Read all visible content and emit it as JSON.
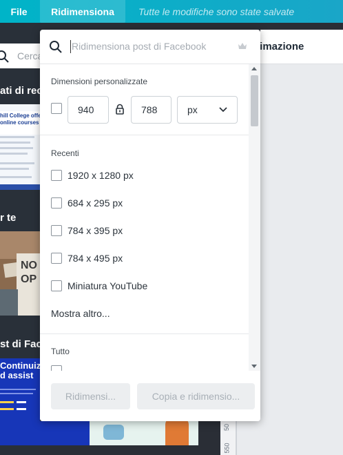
{
  "topbar": {
    "file_label": "File",
    "resize_label": "Ridimensiona",
    "saved_status": "Tutte le modifiche sono state salvate"
  },
  "left_panel": {
    "search_placeholder": "Cerca",
    "heading_1": "ati di rec",
    "heading_2": "r te",
    "heading_3": "st di Face",
    "thumb_text_1": "hill College offers\nonline courses",
    "thumb_text_2": "NO\nOP",
    "thumb_text_3": "Continuiz\nd assist"
  },
  "behind": {
    "tab_label": "nimazione",
    "ruler_marks": [
      "50",
      "550"
    ]
  },
  "popup": {
    "search_placeholder": "Ridimensiona post di Facebook",
    "custom_title": "Dimensioni personalizzate",
    "width_value": "940",
    "height_value": "788",
    "unit_value": "px",
    "recent_title": "Recenti",
    "recent_items": [
      "1920 x 1280 px",
      "684 x 295 px",
      "784 x 395 px",
      "784 x 495 px",
      "Miniatura YouTube"
    ],
    "show_more": "Mostra altro...",
    "all_title": "Tutto",
    "resize_button": "Ridimensi...",
    "copy_resize_button": "Copia e ridimensio..."
  },
  "colors": {
    "topbar": "#00b4c8",
    "panel_bg": "#293039",
    "button_disabled": "#eceef0"
  }
}
